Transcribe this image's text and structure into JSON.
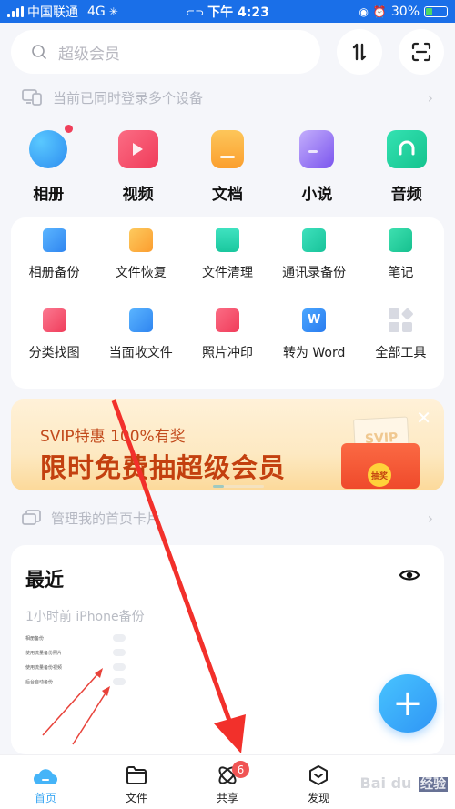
{
  "status_bar": {
    "carrier": "中国联通",
    "network": "4G",
    "time": "下午 4:23",
    "battery": "30%",
    "battery_level": 0.3
  },
  "search": {
    "placeholder": "超级会员",
    "sort_icon_label": "1↓",
    "scan_icon": "scan-icon"
  },
  "device_notice": {
    "text": "当前已同时登录多个设备"
  },
  "categories": [
    {
      "label": "相册",
      "icon": "album-icon",
      "color": "#3aa0f5",
      "has_dot": true
    },
    {
      "label": "视频",
      "icon": "video-icon",
      "color": "#f4566f"
    },
    {
      "label": "文档",
      "icon": "document-icon",
      "color": "#fbb040"
    },
    {
      "label": "小说",
      "icon": "novel-icon",
      "color": "#8a6ef0"
    },
    {
      "label": "音频",
      "icon": "audio-icon",
      "color": "#22d0a0"
    }
  ],
  "tools": [
    {
      "label": "相册备份",
      "icon": "photo-backup-icon",
      "color": "#3f98f5"
    },
    {
      "label": "文件恢复",
      "icon": "file-restore-icon",
      "color": "#fbaa3c"
    },
    {
      "label": "文件清理",
      "icon": "file-clean-icon",
      "color": "#2ad4b0"
    },
    {
      "label": "通讯录备份",
      "icon": "contacts-backup-icon",
      "color": "#27cfa9"
    },
    {
      "label": "笔记",
      "icon": "note-icon",
      "color": "#27d0a2"
    },
    {
      "label": "分类找图",
      "icon": "image-search-icon",
      "color": "#f4566f"
    },
    {
      "label": "当面收文件",
      "icon": "receive-file-icon",
      "color": "#3c98f0"
    },
    {
      "label": "照片冲印",
      "icon": "photo-print-icon",
      "color": "#f4566f"
    },
    {
      "label": "转为 Word",
      "icon": "word-convert-icon",
      "color": "#3b8ff0"
    },
    {
      "label": "全部工具",
      "icon": "all-tools-icon",
      "color": "#d8dae2"
    }
  ],
  "banner": {
    "subtitle": "SVIP特惠 100%有奖",
    "title": "限时免费抽超级会员",
    "card_text": "SVIP",
    "button_text": "抽奖",
    "carousel_position": "1/4"
  },
  "manage_cards": {
    "text": "管理我的首页卡片"
  },
  "recent": {
    "title": "最近",
    "subtitle": "1小时前 iPhone备份",
    "thumbnail_rows": [
      "相册备份",
      "使用流量备份照片",
      "使用流量备份视频",
      "后台自动备份"
    ]
  },
  "fab": {
    "label": "+"
  },
  "tabbar": {
    "tabs": [
      {
        "label": "首页",
        "icon": "home-cloud-icon",
        "active": true
      },
      {
        "label": "文件",
        "icon": "folder-icon"
      },
      {
        "label": "共享",
        "icon": "share-orbit-icon",
        "badge": "6"
      },
      {
        "label": "发现",
        "icon": "discover-icon"
      },
      {
        "label": "",
        "icon": "mine-icon"
      }
    ]
  },
  "watermark": {
    "text": "Bai du",
    "tag": "经验"
  }
}
